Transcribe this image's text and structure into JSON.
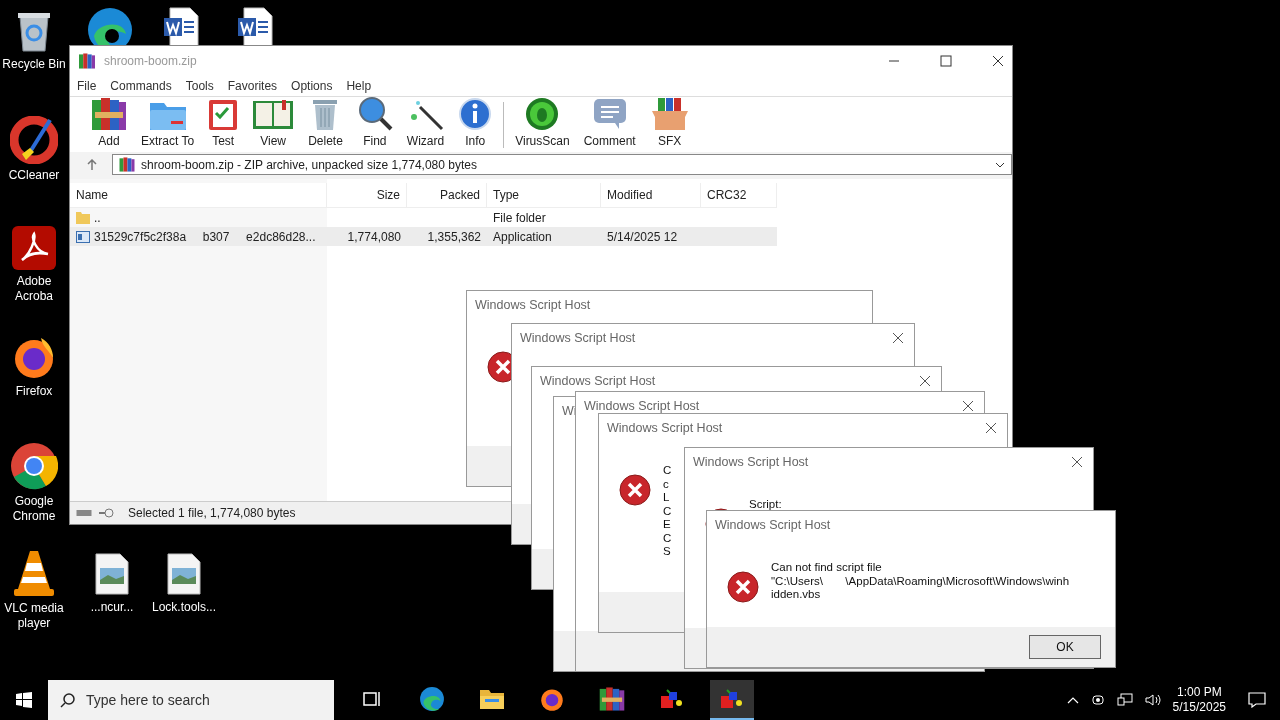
{
  "desktop": {
    "icons": [
      {
        "kind": "recycle",
        "label": "Recycle Bin"
      },
      {
        "kind": "edge"
      },
      {
        "kind": "word"
      },
      {
        "kind": "word"
      },
      {
        "kind": "ccleaner",
        "label": "CCleaner"
      },
      {
        "kind": "acrobat",
        "label": "Adobe Acroba"
      },
      {
        "kind": "firefox",
        "label": "Firefox"
      },
      {
        "kind": "chrome",
        "label": "Google Chrome"
      },
      {
        "kind": "vlc",
        "label": "VLC media player"
      },
      {
        "kind": "image",
        "label": "...ncur..."
      },
      {
        "kind": "image",
        "label": "Lock.tools..."
      }
    ]
  },
  "winrar": {
    "title": "shroom-boom.zip",
    "menu": [
      "File",
      "Commands",
      "Tools",
      "Favorites",
      "Options",
      "Help"
    ],
    "toolbar": [
      {
        "kind": "add",
        "label": "Add"
      },
      {
        "kind": "extract",
        "label": "Extract To"
      },
      {
        "kind": "test",
        "label": "Test"
      },
      {
        "kind": "view",
        "label": "View"
      },
      {
        "kind": "delete",
        "label": "Delete"
      },
      {
        "kind": "find",
        "label": "Find"
      },
      {
        "kind": "wizard",
        "label": "Wizard"
      },
      {
        "kind": "info",
        "label": "Info"
      },
      {
        "kind": "virus",
        "label": "VirusScan"
      },
      {
        "kind": "comment",
        "label": "Comment"
      },
      {
        "kind": "sfx",
        "label": "SFX"
      }
    ],
    "address": "shroom-boom.zip - ZIP archive, unpacked size 1,774,080 bytes",
    "columns": [
      "Name",
      "Size",
      "Packed",
      "Type",
      "Modified",
      "CRC32"
    ],
    "rows": [
      {
        "kind": "folder",
        "selected": false,
        "cells": [
          "..",
          "",
          "",
          "File folder",
          "",
          ""
        ]
      },
      {
        "kind": "app",
        "selected": true,
        "cells": [
          "31529c7f5c2f38a     b307     e2dc86d28...",
          "1,774,080",
          "1,355,362",
          "Application",
          "5/14/2025 12",
          ""
        ]
      }
    ],
    "status": "Selected 1 file, 1,774,080 bytes"
  },
  "dialogs": [
    {
      "title": "Windows Script Host",
      "close": false,
      "icon": true
    },
    {
      "title": "Windows Script Host",
      "close": true,
      "icon": false
    },
    {
      "title": "Windows Script Host",
      "close": true,
      "icon": false
    },
    {
      "title": "Wi",
      "close": false,
      "icon": false
    },
    {
      "title": "Windows Script Host",
      "close": true,
      "icon": false
    },
    {
      "title": "Windows Script Host",
      "close": true,
      "icon": true,
      "message": [
        "C",
        "c",
        "L",
        "C",
        "E",
        "C",
        "S"
      ]
    },
    {
      "title": "Windows Script Host",
      "close": true,
      "icon": true,
      "message": [
        "Script:"
      ]
    },
    {
      "title": "Windows Script Host",
      "close": false,
      "icon": true,
      "message": [
        "Can not find script file",
        "\"C:\\Users\\       \\AppData\\Roaming\\Microsoft\\Windows\\winh",
        "idden.vbs"
      ],
      "button": "OK"
    }
  ],
  "taskbar": {
    "search": {
      "placeholder": "Type here to search"
    },
    "apps": [
      {
        "kind": "taskview",
        "active": false
      },
      {
        "kind": "edge",
        "active": false
      },
      {
        "kind": "explorer",
        "active": false
      },
      {
        "kind": "firefox",
        "active": false
      },
      {
        "kind": "winrar",
        "active": false
      },
      {
        "kind": "script",
        "active": false
      },
      {
        "kind": "script",
        "active": true
      }
    ],
    "time": "1:00 PM",
    "date": "5/15/2025"
  }
}
